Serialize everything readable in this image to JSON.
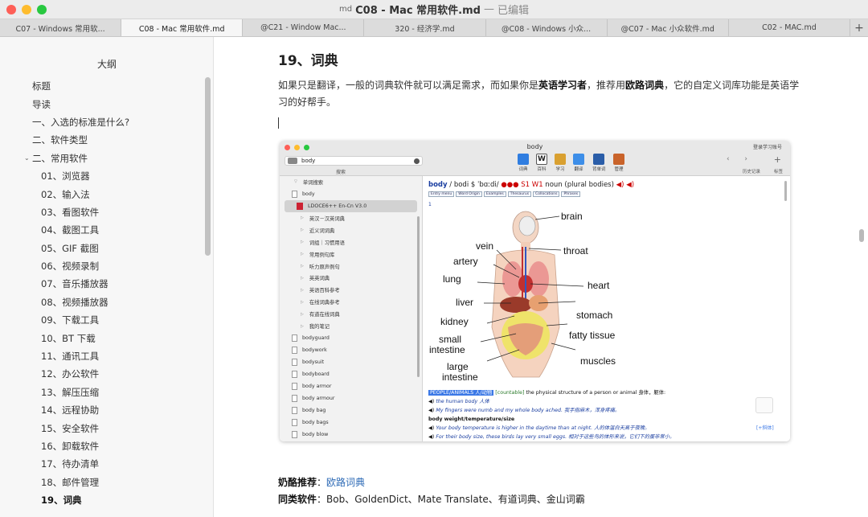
{
  "window": {
    "title": "C08 - Mac 常用软件.md",
    "separator": "—",
    "status": "已编辑",
    "doc_icon": "md",
    "traffic_lights": {
      "close": "#fe5f57",
      "minimize": "#febc2e",
      "zoom": "#28c840"
    }
  },
  "tabs": [
    {
      "label": "C07 - Windows 常用软..."
    },
    {
      "label": "C08 - Mac 常用软件.md",
      "active": true
    },
    {
      "label": "@C21 - Window Mac..."
    },
    {
      "label": "320 - 经济学.md"
    },
    {
      "label": "@C08 - Windows 小众..."
    },
    {
      "label": "@C07 - Mac 小众软件.md"
    },
    {
      "label": "C02 - MAC.md"
    }
  ],
  "tab_add": "+",
  "sidebar": {
    "title": "大纲",
    "items": [
      {
        "label": "标题"
      },
      {
        "label": "导读"
      },
      {
        "label": "一、入选的标准是什么?"
      },
      {
        "label": "二、软件类型"
      },
      {
        "label": "二、常用软件",
        "chevron": "⌄"
      },
      {
        "label": "01、浏览器"
      },
      {
        "label": "02、输入法"
      },
      {
        "label": "03、看图软件"
      },
      {
        "label": "04、截图工具"
      },
      {
        "label": "05、GIF 截图"
      },
      {
        "label": "06、视频录制"
      },
      {
        "label": "07、音乐播放器"
      },
      {
        "label": "08、视频播放器"
      },
      {
        "label": "09、下载工具"
      },
      {
        "label": "10、BT 下载"
      },
      {
        "label": "11、通讯工具"
      },
      {
        "label": "12、办公软件"
      },
      {
        "label": "13、解压压缩"
      },
      {
        "label": "14、远程协助"
      },
      {
        "label": "15、安全软件"
      },
      {
        "label": "16、卸载软件"
      },
      {
        "label": "17、待办清单"
      },
      {
        "label": "18、邮件管理"
      },
      {
        "label": "19、词典",
        "current": true
      }
    ]
  },
  "content": {
    "heading": "19、词典",
    "para": {
      "t1": "如果只是翻译，一般的词典软件就可以满足需求，而如果你是",
      "b1": "英语学习者",
      "t2": "，推荐用",
      "b2": "欧路词典",
      "t3": "，它的自定义词库功能是英语学习的好帮手。"
    },
    "footer": {
      "rec_label": "奶酪推荐",
      "colon": "：",
      "rec_link": "欧路词典",
      "alt_label": "同类软件",
      "alt_text": "Bob、GoldenDict、Mate Translate、有道词典、金山词霸"
    }
  },
  "screenshot": {
    "title": "body",
    "search_value": "body",
    "search_caption": "搜索",
    "tools": [
      {
        "label": "词典",
        "color": "#2f7de0"
      },
      {
        "label": "百科",
        "color": "#3a3a3a"
      },
      {
        "label": "学习",
        "color": "#d9a030"
      },
      {
        "label": "翻译",
        "color": "#3d8ee8"
      },
      {
        "label": "背单词",
        "color": "#2a5da8"
      },
      {
        "label": "管理",
        "color": "#c9632a"
      }
    ],
    "login": "登录学习账号",
    "nav": "‹ ›",
    "nav_caption": "历史记录",
    "plus": "+",
    "plus_caption": "标签",
    "list": [
      {
        "type": "tri",
        "label": "单词搜索"
      },
      {
        "type": "page",
        "label": "body"
      },
      {
        "type": "book",
        "label": "LDOCE6++ En-Cn V3.0",
        "hl": true
      },
      {
        "type": "tri2",
        "label": "英汉－汉英词典"
      },
      {
        "type": "tri2",
        "label": "近义词词典"
      },
      {
        "type": "tri2",
        "label": "词组｜习惯用语"
      },
      {
        "type": "tri2",
        "label": "常用例句库"
      },
      {
        "type": "tri2",
        "label": "听力原声例句"
      },
      {
        "type": "tri2",
        "label": "英英词典"
      },
      {
        "type": "tri2",
        "label": "英语百科参考"
      },
      {
        "type": "tri2",
        "label": "在线词典参考"
      },
      {
        "type": "tri2",
        "label": "有道在线词典"
      },
      {
        "type": "tri2",
        "label": "我的笔记"
      },
      {
        "type": "page",
        "label": "bodyguard"
      },
      {
        "type": "page",
        "label": "bodywork"
      },
      {
        "type": "page",
        "label": "bodysuit"
      },
      {
        "type": "page",
        "label": "bodyboard"
      },
      {
        "type": "page",
        "label": "body armor"
      },
      {
        "type": "page",
        "label": "body armour"
      },
      {
        "type": "page",
        "label": "body bag"
      },
      {
        "type": "page",
        "label": "body bags"
      },
      {
        "type": "page",
        "label": "body blow"
      }
    ],
    "entry": {
      "word": "body",
      "pron": " / bodi $ ˈbɑːdi/ ",
      "dots": "●●●",
      "s1": "S1",
      "w1": "W1",
      "pos": " noun (plural bodies)",
      "chips": [
        "Entry menu",
        "Word Origin",
        "Examples",
        "Thesaurus",
        "Collocations",
        "Phrases"
      ],
      "sense": "1"
    },
    "figure_labels": {
      "brain": "brain",
      "vein": "vein",
      "throat": "throat",
      "artery": "artery",
      "lung": "lung",
      "heart": "heart",
      "liver": "liver",
      "stomach": "stomach",
      "kidney": "kidney",
      "fatty": "fatty tissue",
      "small": "small",
      "intestine1": "intestine",
      "muscles": "muscles",
      "large": "large",
      "intestine2": "intestine"
    },
    "defs": {
      "tag": "PEOPLE/ANIMALS 人/动物",
      "gram": "[countable]",
      "def": " the physical structure of a person or animal  身体，躯体:",
      "ex1": "the human body 人体",
      "ex2": "My fingers were numb and my whole body ached. 我手指麻木，浑身疼痛。",
      "sub": "body weight/temperature/size",
      "ex3": "Your body temperature is higher in the daytime than at night. 人的体温白天高于夜晚。",
      "ex4": "For their body size, these birds lay very small eggs. 相对于这些鸟的体形来说，它们下的蛋非常小。"
    },
    "more": "[+斜体]"
  }
}
